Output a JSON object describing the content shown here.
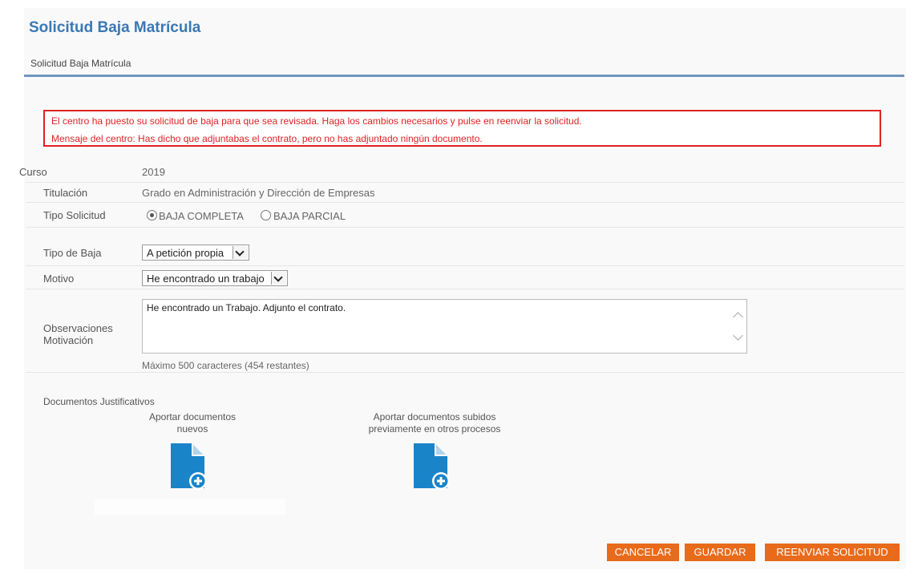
{
  "page_title": "Solicitud Baja Matrícula",
  "section_title": "Solicitud Baja Matrícula",
  "alert": {
    "line1": "El centro ha puesto su solicitud de baja para que sea revisada. Haga los cambios necesarios y pulse en reenviar la solicitud.",
    "line2": "Mensaje del centro: Has dicho que adjuntabas el contrato, pero no has adjuntado ningún documento."
  },
  "form": {
    "curso_label": "Curso",
    "curso_value": "2019",
    "titulacion_label": "Titulación",
    "titulacion_value": "Grado en Administración y Dirección de Empresas",
    "tipo_solicitud_label": "Tipo Solicitud",
    "tipo_solicitud_options": [
      "BAJA COMPLETA",
      "BAJA PARCIAL"
    ],
    "tipo_solicitud_selected": "BAJA COMPLETA",
    "tipo_baja_label": "Tipo de Baja",
    "tipo_baja_value": "A petición propia",
    "motivo_label": "Motivo",
    "motivo_value": "He encontrado un trabajo",
    "observaciones_label_1": "Observaciones",
    "observaciones_label_2": "Motivación",
    "observaciones_value": "He encontrado un Trabajo. Adjunto el contrato.",
    "char_count": "Máximo 500 caracteres (454 restantes)"
  },
  "documents": {
    "label": "Documentos Justificativos",
    "new_docs_line1": "Aportar documentos",
    "new_docs_line2": "nuevos",
    "prev_docs_line1": "Aportar documentos subidos",
    "prev_docs_line2": "previamente en otros procesos"
  },
  "buttons": {
    "cancel": "CANCELAR",
    "save": "GUARDAR",
    "resend": "REENVIAR SOLICITUD"
  },
  "colors": {
    "title_blue": "#3a78b4",
    "alert_red": "#e02222",
    "button_orange": "#e86a1b",
    "doc_icon_blue": "#1a84c9"
  }
}
